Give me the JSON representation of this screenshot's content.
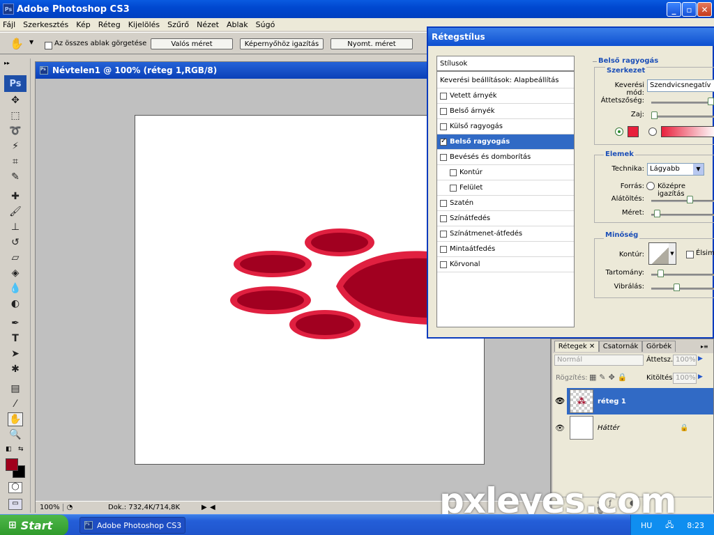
{
  "app": {
    "title": "Adobe Photoshop CS3"
  },
  "menu": [
    "Fájl",
    "Szerkesztés",
    "Kép",
    "Réteg",
    "Kijelölés",
    "Szűrő",
    "Nézet",
    "Ablak",
    "Súgó"
  ],
  "options": {
    "scroll_all_label": "Az összes ablak görgetése",
    "actual_pixels": "Valós méret",
    "fit_screen": "Képernyőhöz igazítás",
    "print_size": "Nyomt. méret"
  },
  "toolbox": {
    "badge": "Ps",
    "fg_color": "#a0001c",
    "bg_color": "#000000"
  },
  "document": {
    "title": "Névtelen1 @ 100% (réteg 1,RGB/8)",
    "zoom": "100%",
    "doc_size": "Dok.: 732,4K/714,8K"
  },
  "dialog": {
    "title": "Rétegstílus",
    "styles_header": "Stílusok",
    "blend_defaults": "Keverési beállítások: Alapbeállítás",
    "styles": [
      {
        "label": "Vetett árnyék",
        "checked": false,
        "indent": false
      },
      {
        "label": "Belső árnyék",
        "checked": false,
        "indent": false
      },
      {
        "label": "Külső ragyogás",
        "checked": false,
        "indent": false
      },
      {
        "label": "Belső ragyogás",
        "checked": true,
        "indent": false
      },
      {
        "label": "Bevésés és domborítás",
        "checked": false,
        "indent": false
      },
      {
        "label": "Kontúr",
        "checked": false,
        "indent": true
      },
      {
        "label": "Felület",
        "checked": false,
        "indent": true
      },
      {
        "label": "Szatén",
        "checked": false,
        "indent": false
      },
      {
        "label": "Színátfedés",
        "checked": false,
        "indent": false
      },
      {
        "label": "Színátmenet-átfedés",
        "checked": false,
        "indent": false
      },
      {
        "label": "Mintaátfedés",
        "checked": false,
        "indent": false
      },
      {
        "label": "Körvonal",
        "checked": false,
        "indent": false
      }
    ],
    "section_title": "Belső ragyogás",
    "structure": {
      "title": "Szerkezet",
      "blend_mode_label": "Keverési mód:",
      "blend_mode_value": "Szendvicsnegatív",
      "opacity_label": "Áttetszőség:",
      "opacity_value": 0.95,
      "noise_label": "Zaj:",
      "noise_value": 0,
      "glow_color": "#e8203c"
    },
    "elements": {
      "title": "Elemek",
      "technique_label": "Technika:",
      "technique_value": "Lágyabb",
      "source_label": "Forrás:",
      "source_value": "Középre igazítás",
      "choke_label": "Alátöltés:",
      "choke_value": 0.6,
      "size_label": "Méret:",
      "size_value": 0.05
    },
    "quality": {
      "title": "Minőség",
      "contour_label": "Kontúr:",
      "antialias_label": "Élsimít",
      "range_label": "Tartomány:",
      "range_value": 0.1,
      "jitter_label": "Vibrálás:",
      "jitter_value": 0.38
    }
  },
  "layers_panel": {
    "tabs": [
      "Rétegek",
      "Csatornák",
      "Görbék"
    ],
    "blend": "Normál",
    "opacity_label": "Áttetsz.:",
    "opacity_value": "100%",
    "lock_label": "Rögzítés:",
    "fill_label": "Kitöltés:",
    "fill_value": "100%",
    "layers": [
      {
        "name": "réteg 1",
        "selected": true
      },
      {
        "name": "Háttér",
        "selected": false
      }
    ]
  },
  "taskbar": {
    "start": "Start",
    "task": "Adobe Photoshop CS3",
    "lang": "HU",
    "time": "8:23"
  },
  "watermark": "pxleyes.com",
  "colors": {
    "paw_fill": "#a10020",
    "paw_edge": "#e02040",
    "selection": "#316ac5"
  }
}
